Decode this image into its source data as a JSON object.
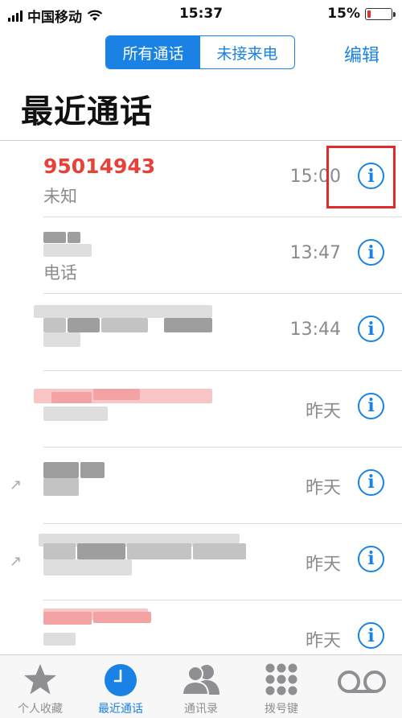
{
  "status_bar": {
    "carrier": "中国移动",
    "time": "15:37",
    "battery": "15%",
    "battery_level": 0.15
  },
  "segmented": {
    "all_label": "所有通话",
    "missed_label": "未接来电"
  },
  "edit_label": "编辑",
  "page_title": "最近通话",
  "calls": [
    {
      "name": "95014943",
      "sub": "未知",
      "time": "15:00"
    },
    {
      "name": "",
      "sub": "电话",
      "time": "13:47"
    },
    {
      "name": "",
      "sub": "",
      "time": "13:44"
    },
    {
      "name": "",
      "sub": "",
      "time": "昨天"
    },
    {
      "name": "",
      "sub": "",
      "time": "昨天"
    },
    {
      "name": "",
      "sub": "",
      "time": "昨天"
    },
    {
      "name": "",
      "sub": "",
      "time": "昨天"
    }
  ],
  "info_glyph": "i",
  "tabs": [
    {
      "label": "个人收藏",
      "icon": "star-icon"
    },
    {
      "label": "最近通话",
      "icon": "clock-icon"
    },
    {
      "label": "通讯录",
      "icon": "contacts-icon"
    },
    {
      "label": "拨号键",
      "icon": "keypad-icon"
    },
    {
      "label": "",
      "icon": "voicemail-icon"
    }
  ],
  "colors": {
    "accent": "#1a82e4",
    "missed": "#e8413a",
    "highlight": "#e12b2b"
  }
}
